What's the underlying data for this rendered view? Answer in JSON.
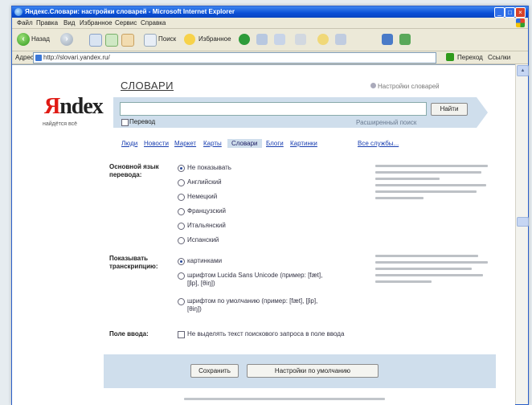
{
  "window": {
    "title": "Яндекс.Словари: настройки словарей - Microsoft Internet Explorer"
  },
  "menu": [
    "Файл",
    "Правка",
    "Вид",
    "Избранное",
    "Сервис",
    "Справка"
  ],
  "toolbar": {
    "back": "Назад",
    "search": "Поиск",
    "favorites": "Избранное"
  },
  "address": {
    "label": "Адрес",
    "url": "http://slovari.yandex.ru/",
    "go": "Переход",
    "links": "Ссылки"
  },
  "page": {
    "heading": "СЛОВАРИ",
    "tune_link": "Настройки словарей",
    "logo_ya": "Я",
    "logo_rest": "ndex",
    "slogan": "найдётся всё",
    "search_button": "Найти",
    "search_checkbox_label": "Перевод",
    "advanced_link": "Расширенный поиск",
    "tabs": [
      "Люди",
      "Новости",
      "Маркет",
      "Карты",
      "Словари",
      "Блоги",
      "Картинки",
      "Все службы..."
    ],
    "active_tab": "Словари"
  },
  "settings": {
    "language": {
      "label_1": "Основной язык",
      "label_2": "перевода:",
      "options": [
        "Не показывать",
        "Английский",
        "Немецкий",
        "Французский",
        "Итальянский",
        "Испанский"
      ],
      "selected": 0
    },
    "transcription": {
      "label_1": "Показывать",
      "label_2": "транскрипцию:",
      "options": [
        [
          "картинками",
          ""
        ],
        [
          "шрифтом Lucida Sans Unicode (пример: [fæt],",
          "[ʃip], [θiŋ])"
        ],
        [
          "шрифтом по умолчанию (пример: [fæt], [ʃip],",
          "[θiŋ])"
        ]
      ],
      "selected": 0
    },
    "input": {
      "label": "Поле ввода:",
      "checkbox_label": "Не выделять текст поискового запроса в поле ввода"
    }
  },
  "buttons": {
    "save": "Сохранить",
    "defaults": "Настройки по умолчанию"
  }
}
